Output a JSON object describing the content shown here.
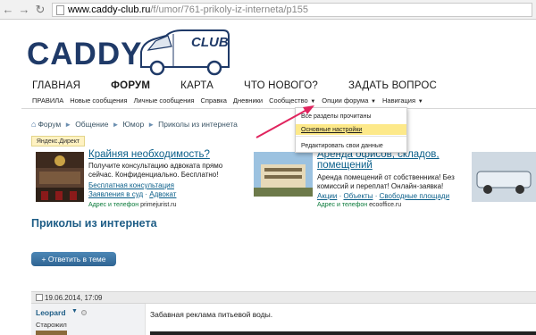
{
  "browser": {
    "url_host": "www.caddy-club.ru",
    "url_path": "/f/umor/761-prikoly-iz-interneta/p155"
  },
  "logo": {
    "text": "CADDY",
    "badge": "CLUB"
  },
  "main_nav": [
    "ГЛАВНАЯ",
    "ФОРУМ",
    "КАРТА",
    "ЧТО НОВОГО?",
    "ЗАДАТЬ ВОПРОС"
  ],
  "sub_nav": [
    "ПРАВИЛА",
    "Новые сообщения",
    "Личные сообщения",
    "Справка",
    "Дневники",
    "Сообщество",
    "Опции форума",
    "Навигация"
  ],
  "breadcrumb": [
    "Форум",
    "Общение",
    "Юмор",
    "Приколы из интернета"
  ],
  "ad_label": "Яндекс.Директ",
  "ads": [
    {
      "title": "Крайняя необходимость?",
      "body": "Получите консультацию адвоката прямо сейчас. Конфиденциально. Бесплатно!",
      "link1": "Бесплатная консультация",
      "link2": "Заявления в суд",
      "link3": "Адвокат",
      "foot_label": "Адрес и телефон",
      "foot_domain": "primejurist.ru"
    },
    {
      "title": "Аренда офисов, складов, помещений",
      "body": "Аренда помещений от собственника! Без комиссий и переплат! Онлайн-заявка!",
      "link1": "Акции",
      "link2": "Объекты",
      "link3": "Свободные площади",
      "foot_label": "Адрес и телефон",
      "foot_domain": "ecooffice.ru"
    }
  ],
  "thread_title": "Приколы из интернета",
  "reply_button": "Ответить в теме",
  "post": {
    "date": "19.06.2014, 17:09",
    "username": "Leopard",
    "rank": "Старожил",
    "text": "Забавная реклама питьевой воды."
  },
  "dropdown": {
    "items": [
      "Все разделы прочитаны",
      "Основные настройки",
      "Редактировать свои данные"
    ],
    "highlighted_index": 1
  },
  "colors": {
    "brand": "#1f3a68",
    "link": "#0b5f8a",
    "highlight": "#fde98a",
    "arrow": "#e0245e"
  }
}
